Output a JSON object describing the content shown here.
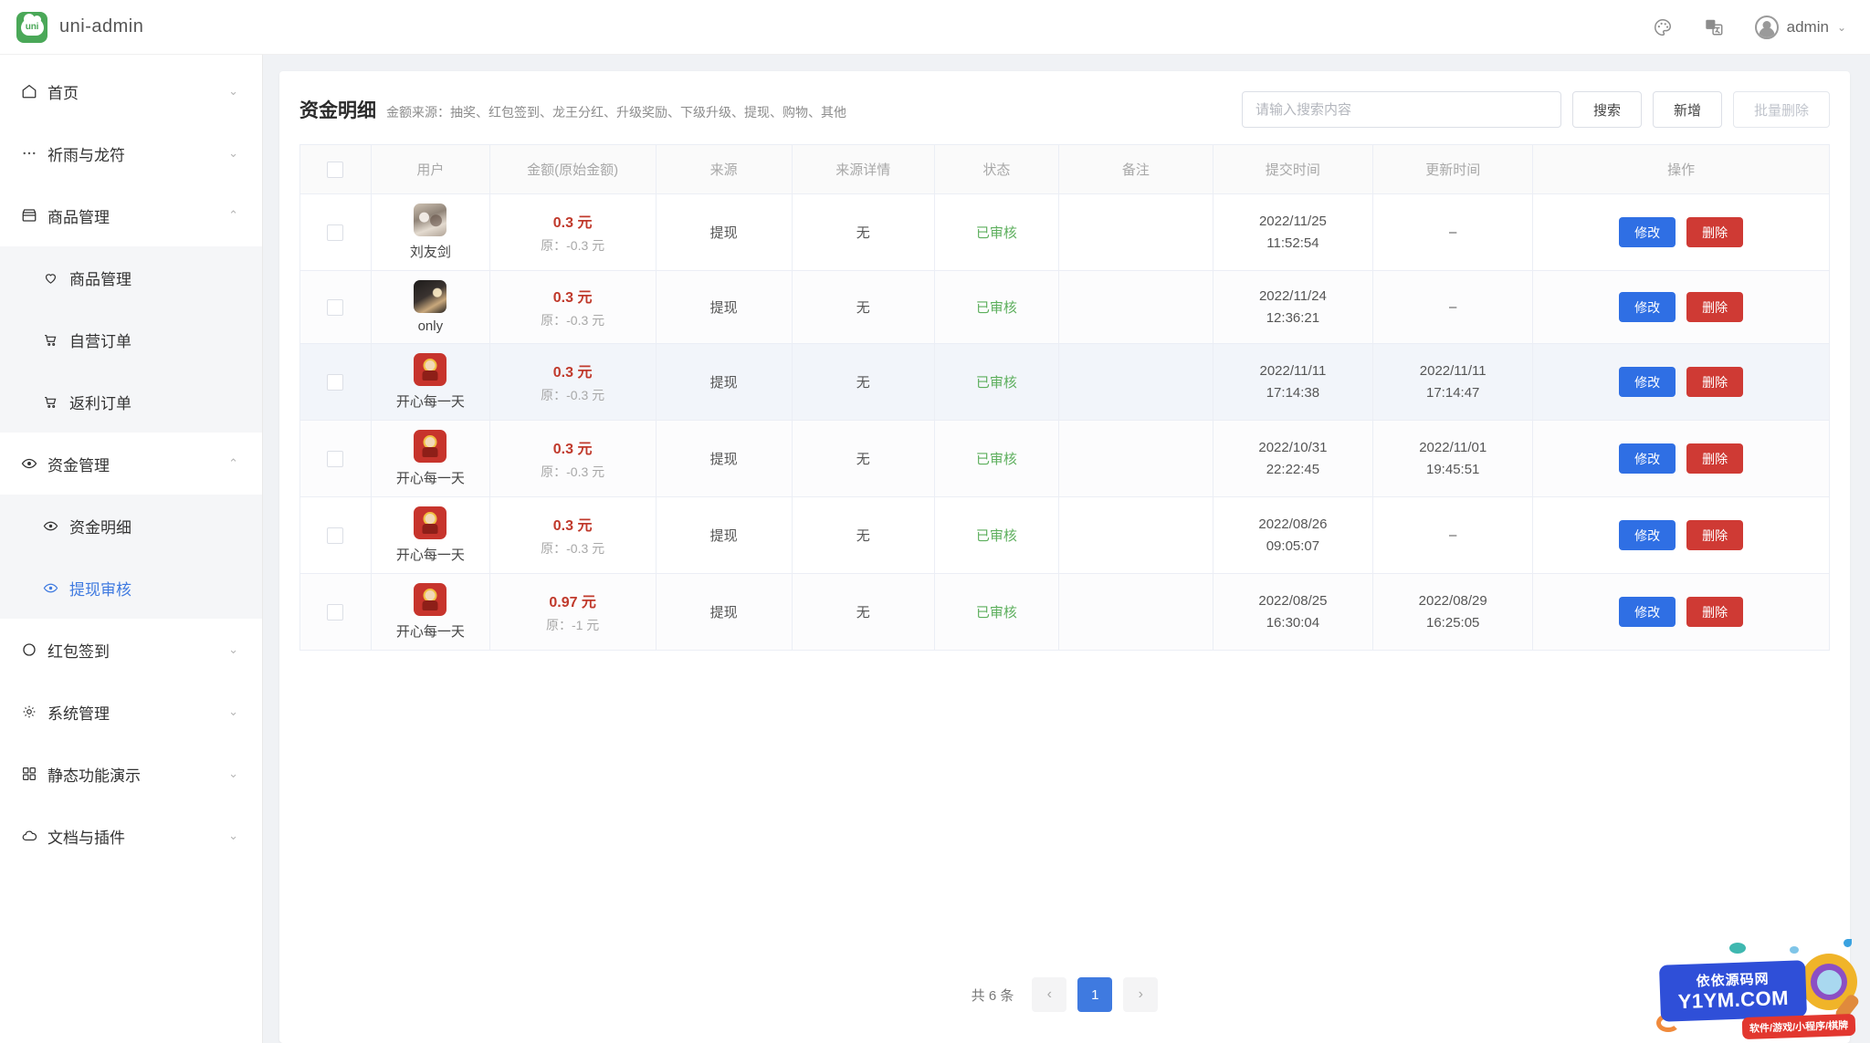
{
  "topbar": {
    "logo_text": "uni",
    "brand": "uni-admin",
    "palette_icon": "palette-icon",
    "translate_icon": "translate-icon",
    "user": "admin",
    "caret": "⌄"
  },
  "sidebar": {
    "items": [
      {
        "label": "首页",
        "icon": "home-icon",
        "chevron": "⌄",
        "expanded": false
      },
      {
        "label": "祈雨与龙符",
        "icon": "dots-icon",
        "chevron": "⌄",
        "expanded": false
      },
      {
        "label": "商品管理",
        "icon": "shop-icon",
        "chevron": "⌃",
        "expanded": true,
        "children": [
          {
            "label": "商品管理",
            "icon": "heart-icon",
            "active": false
          },
          {
            "label": "自营订单",
            "icon": "cart-icon",
            "active": false
          },
          {
            "label": "返利订单",
            "icon": "cart-icon",
            "active": false
          }
        ]
      },
      {
        "label": "资金管理",
        "icon": "eye-icon",
        "chevron": "⌃",
        "expanded": true,
        "children": [
          {
            "label": "资金明细",
            "icon": "eye-icon",
            "active": false
          },
          {
            "label": "提现审核",
            "icon": "eye-icon",
            "active": true
          }
        ]
      },
      {
        "label": "红包签到",
        "icon": "circle-icon",
        "chevron": "⌄",
        "expanded": false
      },
      {
        "label": "系统管理",
        "icon": "gear-icon",
        "chevron": "⌄",
        "expanded": false
      },
      {
        "label": "静态功能演示",
        "icon": "grid-icon",
        "chevron": "⌄",
        "expanded": false
      },
      {
        "label": "文档与插件",
        "icon": "cloud-icon",
        "chevron": "⌄",
        "expanded": false
      }
    ]
  },
  "card": {
    "title": "资金明细",
    "subtitle": "金额来源：抽奖、红包签到、龙王分红、升级奖励、下级升级、提现、购物、其他",
    "search_placeholder": "请输入搜索内容",
    "search_value": "",
    "search_button": "搜索",
    "add_button": "新增",
    "batch_delete_button": "批量删除"
  },
  "table": {
    "columns": [
      "",
      "用户",
      "金额(原始金额)",
      "来源",
      "来源详情",
      "状态",
      "备注",
      "提交时间",
      "更新时间",
      "操作"
    ],
    "edit_label": "修改",
    "delete_label": "删除",
    "rows": [
      {
        "user": "刘友剑",
        "avatar": "photo1",
        "amount": "0.3 元",
        "original": "原：-0.3 元",
        "source": "提现",
        "detail": "无",
        "status": "已审核",
        "remark": "",
        "submit_date": "2022/11/25",
        "submit_time": "11:52:54",
        "update_date": "–",
        "update_time": ""
      },
      {
        "user": "only",
        "avatar": "photo2",
        "amount": "0.3 元",
        "original": "原：-0.3 元",
        "source": "提现",
        "detail": "无",
        "status": "已审核",
        "remark": "",
        "submit_date": "2022/11/24",
        "submit_time": "12:36:21",
        "update_date": "–",
        "update_time": ""
      },
      {
        "user": "开心每一天",
        "avatar": "red",
        "amount": "0.3 元",
        "original": "原：-0.3 元",
        "source": "提现",
        "detail": "无",
        "status": "已审核",
        "remark": "",
        "submit_date": "2022/11/11",
        "submit_time": "17:14:38",
        "update_date": "2022/11/11",
        "update_time": "17:14:47"
      },
      {
        "user": "开心每一天",
        "avatar": "red",
        "amount": "0.3 元",
        "original": "原：-0.3 元",
        "source": "提现",
        "detail": "无",
        "status": "已审核",
        "remark": "",
        "submit_date": "2022/10/31",
        "submit_time": "22:22:45",
        "update_date": "2022/11/01",
        "update_time": "19:45:51"
      },
      {
        "user": "开心每一天",
        "avatar": "red",
        "amount": "0.3 元",
        "original": "原：-0.3 元",
        "source": "提现",
        "detail": "无",
        "status": "已审核",
        "remark": "",
        "submit_date": "2022/08/26",
        "submit_time": "09:05:07",
        "update_date": "–",
        "update_time": ""
      },
      {
        "user": "开心每一天",
        "avatar": "red",
        "amount": "0.97 元",
        "original": "原：-1 元",
        "source": "提现",
        "detail": "无",
        "status": "已审核",
        "remark": "",
        "submit_date": "2022/08/25",
        "submit_time": "16:30:04",
        "update_date": "2022/08/29",
        "update_time": "16:25:05"
      }
    ]
  },
  "pager": {
    "total": "共 6 条",
    "prev": "‹",
    "next": "›",
    "pages": [
      "1"
    ],
    "current": "1"
  },
  "watermark": {
    "cn": "依依源码网",
    "en": "Y1YM.COM",
    "tag": "软件/游戏/小程序/棋牌"
  },
  "colors": {
    "accent": "#3f7ae0",
    "brand_green": "#4aa858",
    "amount_red": "#c0392b",
    "status_green": "#5daf5d",
    "delete_red": "#cf3a34"
  }
}
